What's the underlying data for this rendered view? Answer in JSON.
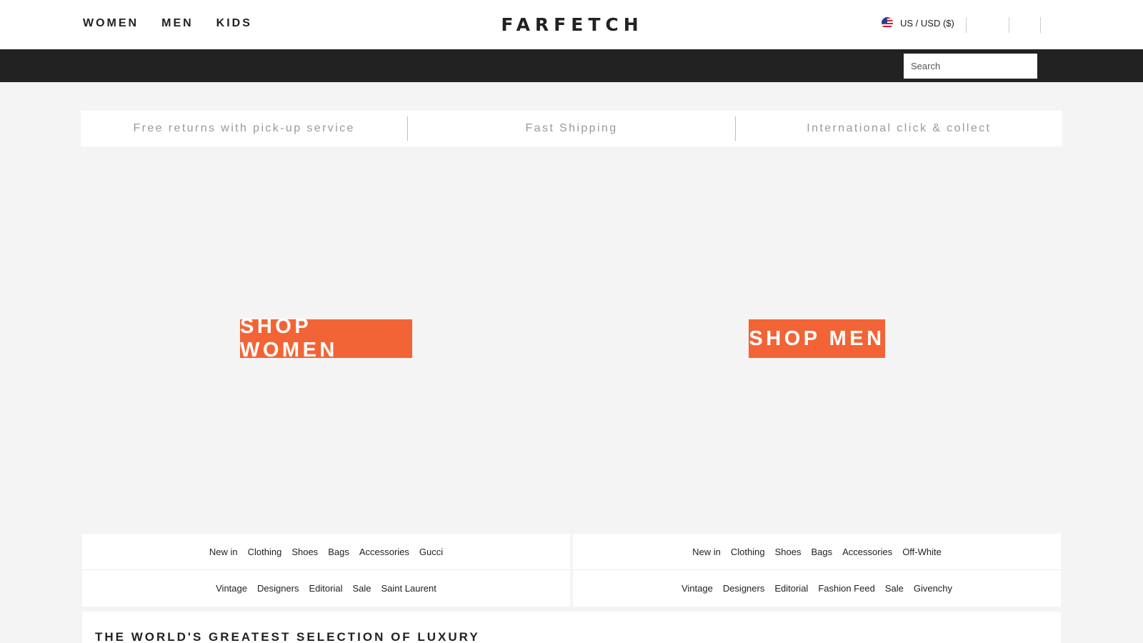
{
  "header": {
    "gender_nav": [
      {
        "label": "WOMEN"
      },
      {
        "label": "MEN"
      },
      {
        "label": "KIDS"
      }
    ],
    "logo_text": "FARFETCH",
    "locale": {
      "label": "US / USD ($)",
      "flag_icon": "us-flag-icon"
    }
  },
  "search": {
    "placeholder": "Search"
  },
  "usp": [
    {
      "label": "Free returns with pick-up service"
    },
    {
      "label": "Fast Shipping"
    },
    {
      "label": "International click & collect"
    }
  ],
  "hero": {
    "women_cta": "SHOP WOMEN",
    "men_cta": "SHOP MEN",
    "accent_color": "#f26436"
  },
  "women_links": {
    "row1": [
      "New in",
      "Clothing",
      "Shoes",
      "Bags",
      "Accessories",
      "Gucci"
    ],
    "row2": [
      "Vintage",
      "Designers",
      "Editorial",
      "Sale",
      "Saint Laurent"
    ]
  },
  "men_links": {
    "row1": [
      "New in",
      "Clothing",
      "Shoes",
      "Bags",
      "Accessories",
      "Off-White"
    ],
    "row2": [
      "Vintage",
      "Designers",
      "Editorial",
      "Fashion Feed",
      "Sale",
      "Givenchy"
    ]
  },
  "section": {
    "heading": "THE WORLD'S GREATEST SELECTION OF LUXURY"
  }
}
